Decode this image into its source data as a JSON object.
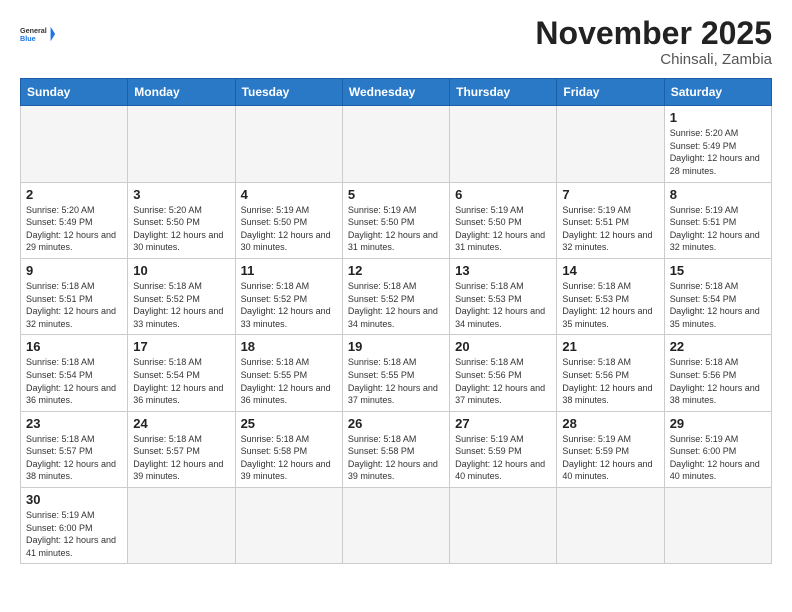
{
  "header": {
    "logo_general": "General",
    "logo_blue": "Blue",
    "month_title": "November 2025",
    "subtitle": "Chinsali, Zambia"
  },
  "weekdays": [
    "Sunday",
    "Monday",
    "Tuesday",
    "Wednesday",
    "Thursday",
    "Friday",
    "Saturday"
  ],
  "weeks": [
    [
      {
        "day": "",
        "empty": true
      },
      {
        "day": "",
        "empty": true
      },
      {
        "day": "",
        "empty": true
      },
      {
        "day": "",
        "empty": true
      },
      {
        "day": "",
        "empty": true
      },
      {
        "day": "",
        "empty": true
      },
      {
        "day": "1",
        "sunrise": "Sunrise: 5:20 AM",
        "sunset": "Sunset: 5:49 PM",
        "daylight": "Daylight: 12 hours and 28 minutes."
      }
    ],
    [
      {
        "day": "2",
        "sunrise": "Sunrise: 5:20 AM",
        "sunset": "Sunset: 5:49 PM",
        "daylight": "Daylight: 12 hours and 29 minutes."
      },
      {
        "day": "3",
        "sunrise": "Sunrise: 5:20 AM",
        "sunset": "Sunset: 5:50 PM",
        "daylight": "Daylight: 12 hours and 30 minutes."
      },
      {
        "day": "4",
        "sunrise": "Sunrise: 5:19 AM",
        "sunset": "Sunset: 5:50 PM",
        "daylight": "Daylight: 12 hours and 30 minutes."
      },
      {
        "day": "5",
        "sunrise": "Sunrise: 5:19 AM",
        "sunset": "Sunset: 5:50 PM",
        "daylight": "Daylight: 12 hours and 31 minutes."
      },
      {
        "day": "6",
        "sunrise": "Sunrise: 5:19 AM",
        "sunset": "Sunset: 5:50 PM",
        "daylight": "Daylight: 12 hours and 31 minutes."
      },
      {
        "day": "7",
        "sunrise": "Sunrise: 5:19 AM",
        "sunset": "Sunset: 5:51 PM",
        "daylight": "Daylight: 12 hours and 32 minutes."
      },
      {
        "day": "8",
        "sunrise": "Sunrise: 5:19 AM",
        "sunset": "Sunset: 5:51 PM",
        "daylight": "Daylight: 12 hours and 32 minutes."
      }
    ],
    [
      {
        "day": "9",
        "sunrise": "Sunrise: 5:18 AM",
        "sunset": "Sunset: 5:51 PM",
        "daylight": "Daylight: 12 hours and 32 minutes."
      },
      {
        "day": "10",
        "sunrise": "Sunrise: 5:18 AM",
        "sunset": "Sunset: 5:52 PM",
        "daylight": "Daylight: 12 hours and 33 minutes."
      },
      {
        "day": "11",
        "sunrise": "Sunrise: 5:18 AM",
        "sunset": "Sunset: 5:52 PM",
        "daylight": "Daylight: 12 hours and 33 minutes."
      },
      {
        "day": "12",
        "sunrise": "Sunrise: 5:18 AM",
        "sunset": "Sunset: 5:52 PM",
        "daylight": "Daylight: 12 hours and 34 minutes."
      },
      {
        "day": "13",
        "sunrise": "Sunrise: 5:18 AM",
        "sunset": "Sunset: 5:53 PM",
        "daylight": "Daylight: 12 hours and 34 minutes."
      },
      {
        "day": "14",
        "sunrise": "Sunrise: 5:18 AM",
        "sunset": "Sunset: 5:53 PM",
        "daylight": "Daylight: 12 hours and 35 minutes."
      },
      {
        "day": "15",
        "sunrise": "Sunrise: 5:18 AM",
        "sunset": "Sunset: 5:54 PM",
        "daylight": "Daylight: 12 hours and 35 minutes."
      }
    ],
    [
      {
        "day": "16",
        "sunrise": "Sunrise: 5:18 AM",
        "sunset": "Sunset: 5:54 PM",
        "daylight": "Daylight: 12 hours and 36 minutes."
      },
      {
        "day": "17",
        "sunrise": "Sunrise: 5:18 AM",
        "sunset": "Sunset: 5:54 PM",
        "daylight": "Daylight: 12 hours and 36 minutes."
      },
      {
        "day": "18",
        "sunrise": "Sunrise: 5:18 AM",
        "sunset": "Sunset: 5:55 PM",
        "daylight": "Daylight: 12 hours and 36 minutes."
      },
      {
        "day": "19",
        "sunrise": "Sunrise: 5:18 AM",
        "sunset": "Sunset: 5:55 PM",
        "daylight": "Daylight: 12 hours and 37 minutes."
      },
      {
        "day": "20",
        "sunrise": "Sunrise: 5:18 AM",
        "sunset": "Sunset: 5:56 PM",
        "daylight": "Daylight: 12 hours and 37 minutes."
      },
      {
        "day": "21",
        "sunrise": "Sunrise: 5:18 AM",
        "sunset": "Sunset: 5:56 PM",
        "daylight": "Daylight: 12 hours and 38 minutes."
      },
      {
        "day": "22",
        "sunrise": "Sunrise: 5:18 AM",
        "sunset": "Sunset: 5:56 PM",
        "daylight": "Daylight: 12 hours and 38 minutes."
      }
    ],
    [
      {
        "day": "23",
        "sunrise": "Sunrise: 5:18 AM",
        "sunset": "Sunset: 5:57 PM",
        "daylight": "Daylight: 12 hours and 38 minutes."
      },
      {
        "day": "24",
        "sunrise": "Sunrise: 5:18 AM",
        "sunset": "Sunset: 5:57 PM",
        "daylight": "Daylight: 12 hours and 39 minutes."
      },
      {
        "day": "25",
        "sunrise": "Sunrise: 5:18 AM",
        "sunset": "Sunset: 5:58 PM",
        "daylight": "Daylight: 12 hours and 39 minutes."
      },
      {
        "day": "26",
        "sunrise": "Sunrise: 5:18 AM",
        "sunset": "Sunset: 5:58 PM",
        "daylight": "Daylight: 12 hours and 39 minutes."
      },
      {
        "day": "27",
        "sunrise": "Sunrise: 5:19 AM",
        "sunset": "Sunset: 5:59 PM",
        "daylight": "Daylight: 12 hours and 40 minutes."
      },
      {
        "day": "28",
        "sunrise": "Sunrise: 5:19 AM",
        "sunset": "Sunset: 5:59 PM",
        "daylight": "Daylight: 12 hours and 40 minutes."
      },
      {
        "day": "29",
        "sunrise": "Sunrise: 5:19 AM",
        "sunset": "Sunset: 6:00 PM",
        "daylight": "Daylight: 12 hours and 40 minutes."
      }
    ],
    [
      {
        "day": "30",
        "sunrise": "Sunrise: 5:19 AM",
        "sunset": "Sunset: 6:00 PM",
        "daylight": "Daylight: 12 hours and 41 minutes."
      },
      {
        "day": "",
        "empty": true
      },
      {
        "day": "",
        "empty": true
      },
      {
        "day": "",
        "empty": true
      },
      {
        "day": "",
        "empty": true
      },
      {
        "day": "",
        "empty": true
      },
      {
        "day": "",
        "empty": true
      }
    ]
  ]
}
